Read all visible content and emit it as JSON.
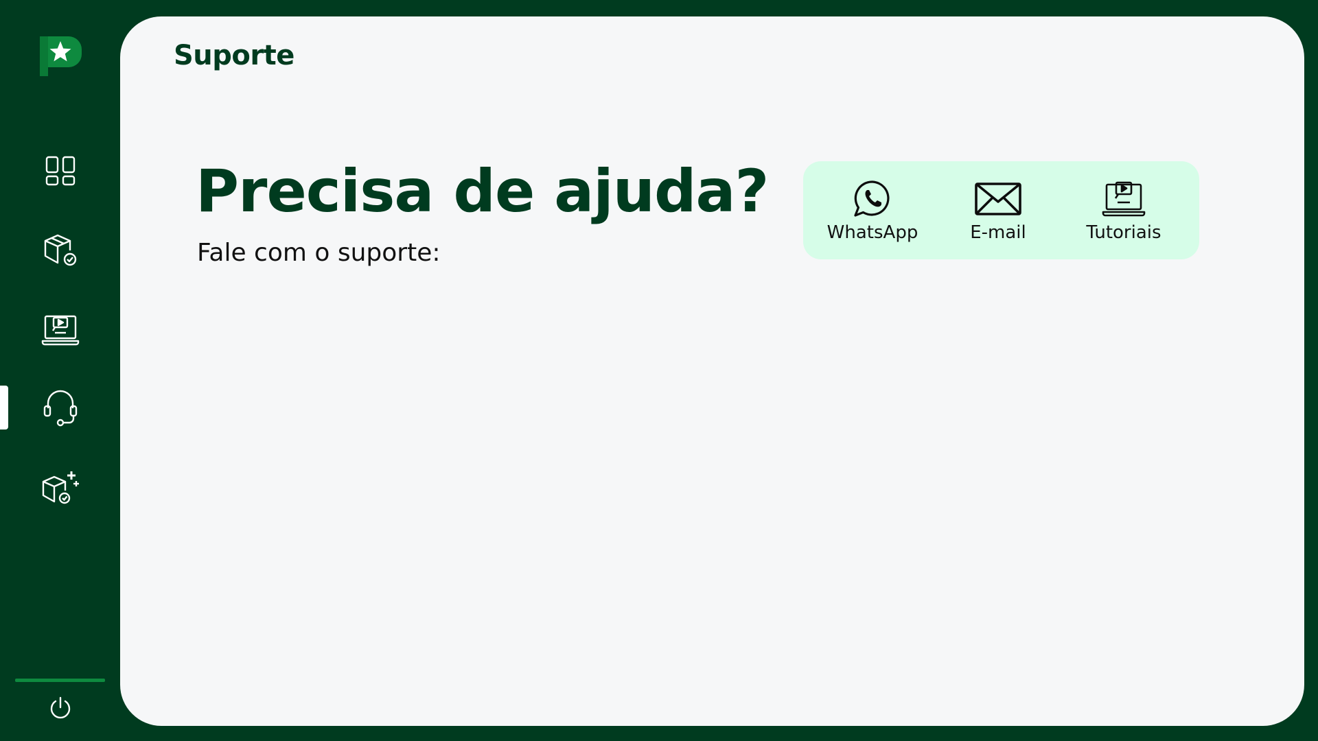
{
  "app": {
    "colors": {
      "sidebar_bg": "#003b1f",
      "panel_bg": "#f6f7f8",
      "brand_green": "#0e8a3f",
      "card_bg": "#d6fde8",
      "title_color": "#003b1f"
    }
  },
  "sidebar": {
    "logo_icon": "brand-logo-star-p",
    "items": [
      {
        "icon": "dashboard-icon",
        "active": false
      },
      {
        "icon": "box-check-icon",
        "active": false
      },
      {
        "icon": "laptop-video-icon",
        "active": false
      },
      {
        "icon": "headset-icon",
        "active": true
      },
      {
        "icon": "box-add-icon",
        "active": false
      }
    ],
    "logout_icon": "power-icon"
  },
  "main": {
    "page_title": "Suporte",
    "hero_title": "Precisa de ajuda?",
    "hero_subtitle": "Fale com o suporte:",
    "contacts": [
      {
        "label": "WhatsApp",
        "icon": "whatsapp-icon"
      },
      {
        "label": "E-mail",
        "icon": "mail-icon"
      },
      {
        "label": "Tutoriais",
        "icon": "laptop-video-icon"
      }
    ]
  }
}
